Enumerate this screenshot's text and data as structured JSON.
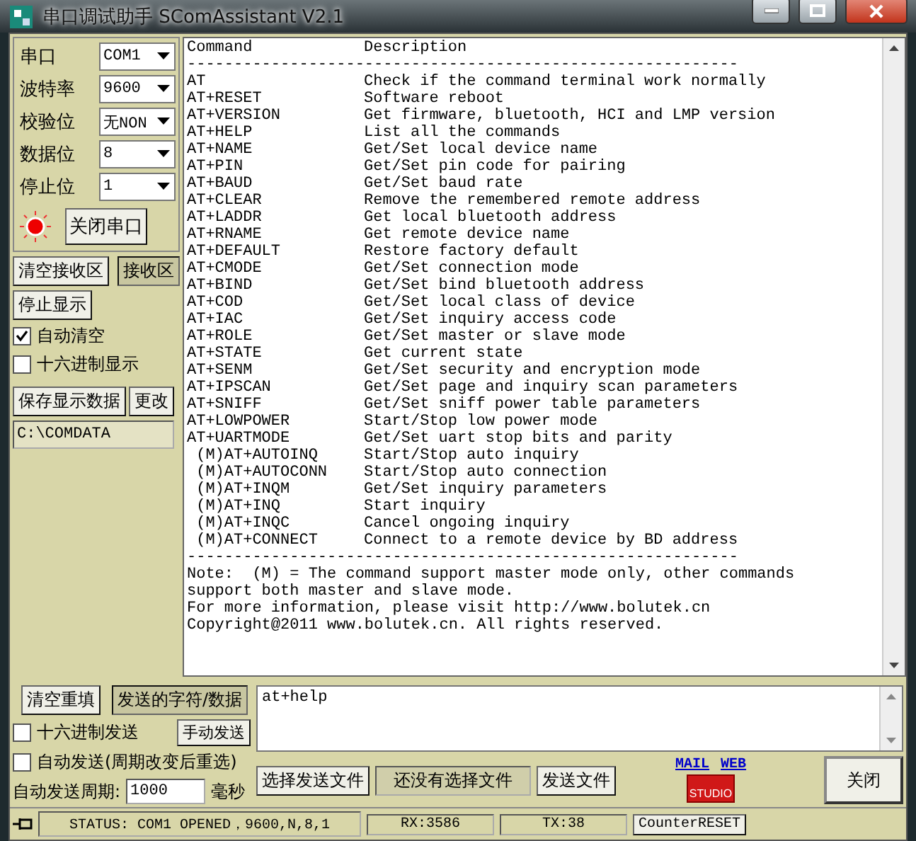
{
  "window": {
    "title": "串口调试助手 SComAssistant V2.1"
  },
  "port_settings": [
    {
      "label": "串口",
      "value": "COM1"
    },
    {
      "label": "波特率",
      "value": "9600"
    },
    {
      "label": "校验位",
      "value": "无NON"
    },
    {
      "label": "数据位",
      "value": "8"
    },
    {
      "label": "停止位",
      "value": "1"
    }
  ],
  "port_indicator": {
    "on": true
  },
  "close_port_button": "关闭串口",
  "clear_receive_button": "清空接收区",
  "receive_area_label": "接收区",
  "stop_display_button": "停止显示",
  "receive_options": [
    {
      "label": "自动清空",
      "checked": true
    },
    {
      "label": "十六进制显示",
      "checked": false
    }
  ],
  "save_data_button": "保存显示数据",
  "change_button": "更改",
  "save_path": "C:\\COMDATA",
  "terminal": {
    "columns": [
      "Command",
      "Description"
    ],
    "separator": "-----------------------------------------------------------",
    "rows": [
      [
        "AT",
        "Check if the command terminal work normally"
      ],
      [
        "AT+RESET",
        "Software reboot"
      ],
      [
        "AT+VERSION",
        "Get firmware, bluetooth, HCI and LMP version"
      ],
      [
        "AT+HELP",
        "List all the commands"
      ],
      [
        "AT+NAME",
        "Get/Set local device name"
      ],
      [
        "AT+PIN",
        "Get/Set pin code for pairing"
      ],
      [
        "AT+BAUD",
        "Get/Set baud rate"
      ],
      [
        "AT+CLEAR",
        "Remove the remembered remote address"
      ],
      [
        "AT+LADDR",
        "Get local bluetooth address"
      ],
      [
        "AT+RNAME",
        "Get remote device name"
      ],
      [
        "AT+DEFAULT",
        "Restore factory default"
      ],
      [
        "AT+CMODE",
        "Get/Set connection mode"
      ],
      [
        "AT+BIND",
        "Get/Set bind bluetooth address"
      ],
      [
        "AT+COD",
        "Get/Set local class of device"
      ],
      [
        "AT+IAC",
        "Get/Set inquiry access code"
      ],
      [
        "AT+ROLE",
        "Get/Set master or slave mode"
      ],
      [
        "AT+STATE",
        "Get current state"
      ],
      [
        "AT+SENM",
        "Get/Set security and encryption mode"
      ],
      [
        "AT+IPSCAN",
        "Get/Set page and inquiry scan parameters"
      ],
      [
        "AT+SNIFF",
        "Get/Set sniff power table parameters"
      ],
      [
        "AT+LOWPOWER",
        "Start/Stop low power mode"
      ],
      [
        "AT+UARTMODE",
        "Get/Set uart stop bits and parity"
      ],
      [
        " (M)AT+AUTOINQ",
        "Start/Stop auto inquiry"
      ],
      [
        " (M)AT+AUTOCONN",
        "Start/Stop auto connection"
      ],
      [
        " (M)AT+INQM",
        "Get/Set inquiry parameters"
      ],
      [
        " (M)AT+INQ",
        "Start inquiry"
      ],
      [
        " (M)AT+INQC",
        "Cancel ongoing inquiry"
      ],
      [
        " (M)AT+CONNECT",
        "Connect to a remote device by BD address"
      ]
    ],
    "notes": [
      "Note:  (M) = The command support master mode only, other commands",
      "support both master and slave mode.",
      "For more information, please visit http://www.bolutek.cn",
      "Copyright@2011 www.bolutek.cn. All rights reserved."
    ]
  },
  "send": {
    "clear_button": "清空重填",
    "data_label": "发送的字符/数据",
    "text": "at+help",
    "hex_send": {
      "label": "十六进制发送",
      "checked": false
    },
    "manual_send_button": "手动发送",
    "auto_send": {
      "label": "自动发送(周期改变后重选)",
      "checked": false
    },
    "period_label": "自动发送周期:",
    "period_value": "1000",
    "period_unit": "毫秒",
    "select_file_button": "选择发送文件",
    "file_status": "还没有选择文件",
    "send_file_button": "发送文件",
    "links": [
      "MAIL",
      "WEB"
    ],
    "logo_text": "STUDIO",
    "close_button": "关闭"
  },
  "status_bar": {
    "status": "STATUS: COM1 OPENED，9600,N,8,1",
    "rx": "RX:3586",
    "tx": "TX:38",
    "counter_reset": "CounterRESET"
  }
}
